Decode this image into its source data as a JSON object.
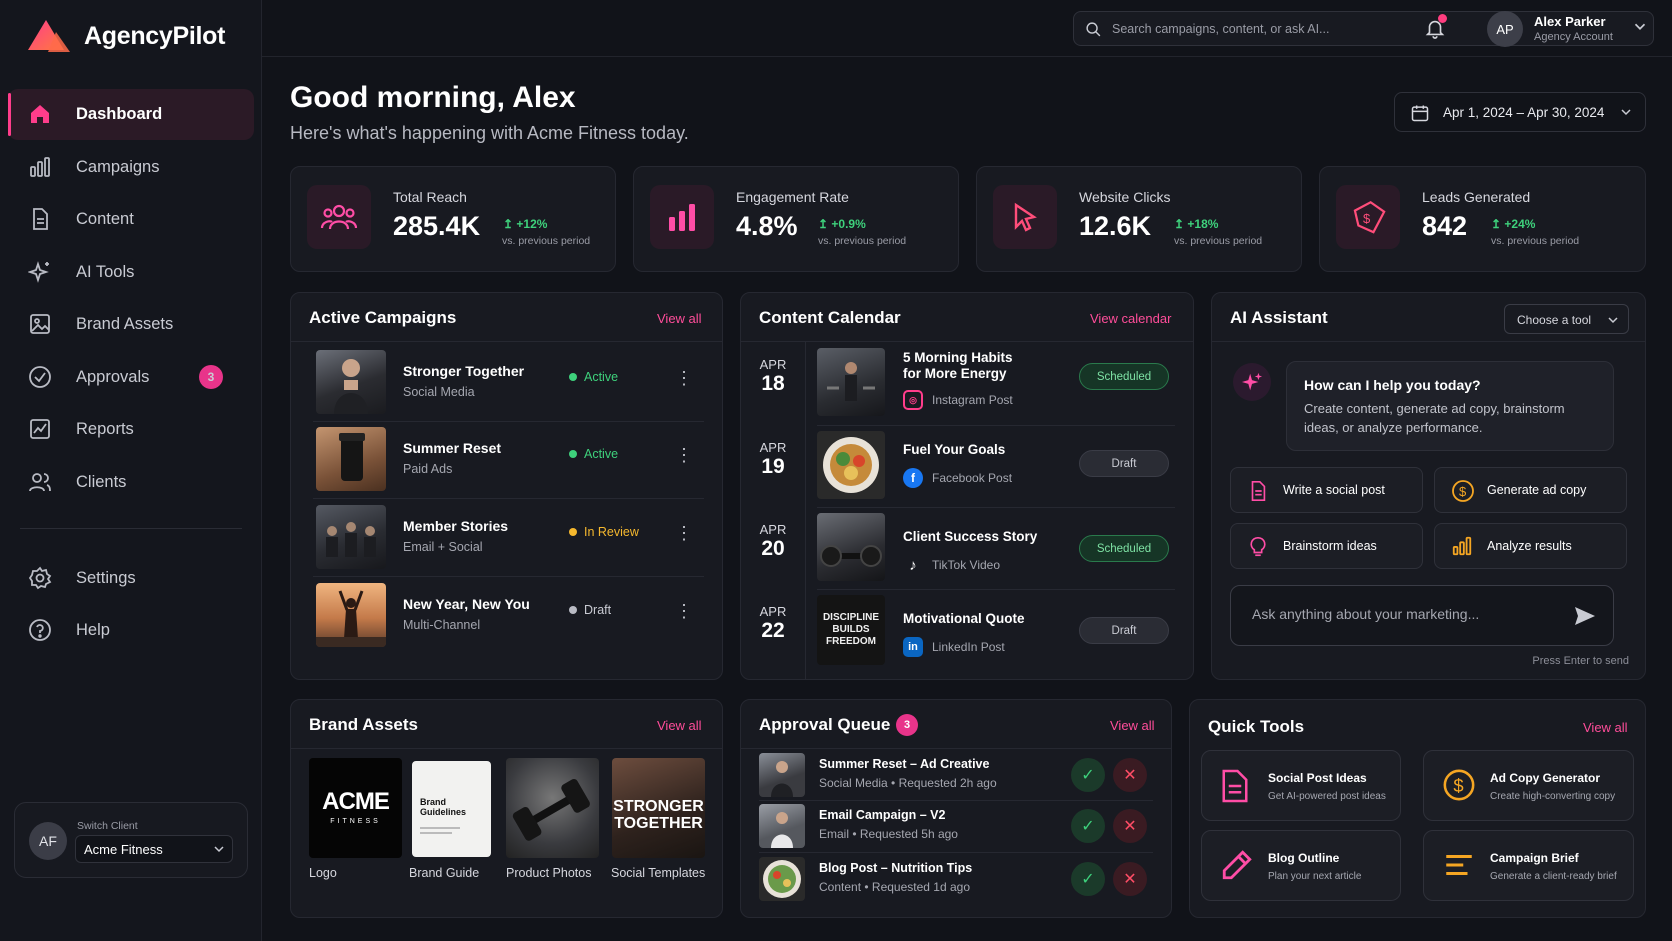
{
  "app": {
    "name": "AgencyPilot",
    "brand_color": "#ff3d8b"
  },
  "sidebar": {
    "items": [
      {
        "label": "Dashboard",
        "icon": "home-icon"
      },
      {
        "label": "Campaigns",
        "icon": "bar-chart-icon"
      },
      {
        "label": "Content",
        "icon": "document-icon"
      },
      {
        "label": "AI Tools",
        "icon": "sparkle-icon"
      },
      {
        "label": "Brand Assets",
        "icon": "image-icon"
      },
      {
        "label": "Approvals",
        "icon": "check-circle-icon",
        "badge": "3"
      },
      {
        "label": "Reports",
        "icon": "trend-chart-icon"
      },
      {
        "label": "Clients",
        "icon": "users-icon"
      }
    ],
    "secondary": [
      {
        "label": "Settings",
        "icon": "gear-icon"
      },
      {
        "label": "Help",
        "icon": "help-circle-icon"
      }
    ],
    "client": {
      "avatar": "AF",
      "label": "Switch Client",
      "value": "Acme Fitness"
    }
  },
  "topbar": {
    "search_placeholder": "Search campaigns, content, or ask AI...",
    "user": {
      "initials": "AP",
      "name": "Alex Parker",
      "role": "Agency Account"
    }
  },
  "header": {
    "greeting": "Good morning, Alex",
    "subtitle": "Here's what's happening with Acme Fitness today.",
    "date_range": "Apr 1, 2024 – Apr 30, 2024"
  },
  "stats": [
    {
      "label": "Total Reach",
      "value": "285.4K",
      "delta": "+12%",
      "vs": "vs. previous period",
      "icon": "users-icon"
    },
    {
      "label": "Engagement Rate",
      "value": "4.8%",
      "delta": "+0.9%",
      "vs": "vs. previous period",
      "icon": "bar-chart-icon"
    },
    {
      "label": "Website Clicks",
      "value": "12.6K",
      "delta": "+18%",
      "vs": "vs. previous period",
      "icon": "cursor-icon"
    },
    {
      "label": "Leads Generated",
      "value": "842",
      "delta": "+24%",
      "vs": "vs. previous period",
      "icon": "tag-dollar-icon"
    }
  ],
  "campaigns": {
    "title": "Active Campaigns",
    "link": "View all",
    "rows": [
      {
        "name": "Stronger Together",
        "type": "Social Media",
        "status": "Active",
        "status_color": "#3ed17c"
      },
      {
        "name": "Summer Reset",
        "type": "Paid Ads",
        "status": "Active",
        "status_color": "#3ed17c"
      },
      {
        "name": "Member Stories",
        "type": "Email + Social",
        "status": "In Review",
        "status_color": "#f5b82e"
      },
      {
        "name": "New Year, New You",
        "type": "Multi-Channel",
        "status": "Draft",
        "status_color": "#b9bbc4"
      }
    ]
  },
  "calendar": {
    "title": "Content Calendar",
    "link": "View calendar",
    "rows": [
      {
        "month": "APR",
        "day": "18",
        "title_line1": "5 Morning Habits",
        "title_line2": "for More Energy",
        "platform": "Instagram Post",
        "platform_icon": "instagram-icon",
        "status": "Scheduled"
      },
      {
        "month": "APR",
        "day": "19",
        "title_line1": "Fuel Your Goals",
        "title_line2": "",
        "platform": "Facebook Post",
        "platform_icon": "facebook-icon",
        "status": "Draft"
      },
      {
        "month": "APR",
        "day": "20",
        "title_line1": "Client Success Story",
        "title_line2": "",
        "platform": "TikTok Video",
        "platform_icon": "tiktok-icon",
        "status": "Scheduled"
      },
      {
        "month": "APR",
        "day": "22",
        "title_line1": "Motivational Quote",
        "title_line2": "",
        "platform": "LinkedIn Post",
        "platform_icon": "linkedin-icon",
        "status": "Draft"
      }
    ],
    "quote_thumb_text": [
      "DISCIPLINE",
      "BUILDS",
      "FREEDOM"
    ]
  },
  "ai": {
    "title": "AI Assistant",
    "tool_select": "Choose a tool",
    "bubble_title": "How can I help you today?",
    "bubble_body_1": "Create content, generate ad copy, brainstorm",
    "bubble_body_2": "ideas, or analyze performance.",
    "chips": [
      "Write a social post",
      "Generate ad copy",
      "Brainstorm ideas",
      "Analyze results"
    ],
    "input_placeholder": "Ask anything about your marketing...",
    "hint": "Press Enter to send"
  },
  "brand_assets": {
    "title": "Brand Assets",
    "link": "View all",
    "items": [
      "Logo",
      "Brand Guide",
      "Product Photos",
      "Social Templates"
    ],
    "logo_text": "ACME",
    "logo_sub": "FITNESS",
    "guide_text_1": "Brand",
    "guide_text_2": "Guidelines",
    "template_text_1": "STRONGER",
    "template_text_2": "TOGETHER"
  },
  "approvals": {
    "title": "Approval Queue",
    "badge": "3",
    "link": "View all",
    "rows": [
      {
        "title": "Summer Reset – Ad Creative",
        "category": "Social Media",
        "requested": "Requested 2h ago"
      },
      {
        "title": "Email Campaign – V2",
        "category": "Email",
        "requested": "Requested 5h ago"
      },
      {
        "title": "Blog Post – Nutrition Tips",
        "category": "Content",
        "requested": "Requested 1d ago"
      }
    ]
  },
  "quick_tools": {
    "title": "Quick Tools",
    "link": "View all",
    "items": [
      {
        "title": "Social Post Ideas",
        "sub": "Get AI-powered post ideas",
        "icon": "document-icon"
      },
      {
        "title": "Ad Copy Generator",
        "sub": "Create high-converting copy",
        "icon": "dollar-icon"
      },
      {
        "title": "Blog Outline",
        "sub": "Plan your next article",
        "icon": "pencil-icon"
      },
      {
        "title": "Campaign Brief",
        "sub": "Generate a client-ready brief",
        "icon": "list-icon"
      }
    ]
  }
}
